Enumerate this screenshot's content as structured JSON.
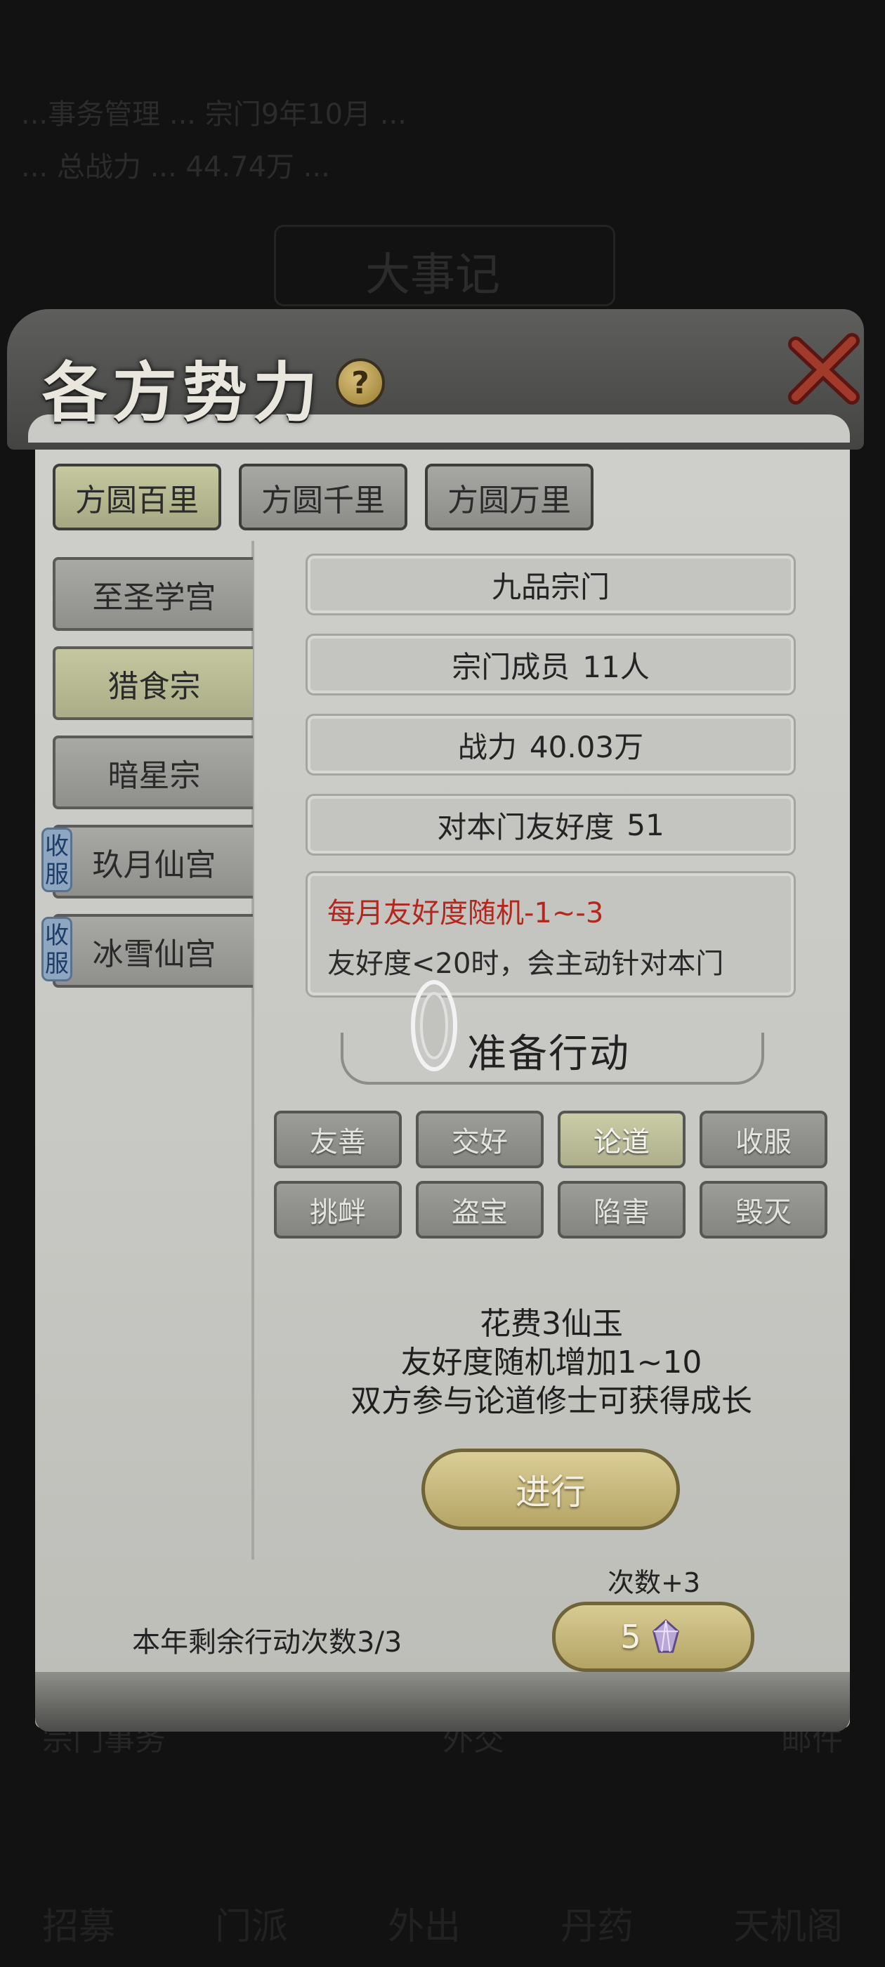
{
  "background": {
    "row1": "...事务管理 ... 宗门9年10月 ... ",
    "row2": "... 总战力 ... 44.74万 ... ",
    "title": "大事记",
    "tabs": [
      "宗门事务",
      "外交",
      "邮件"
    ],
    "bottom": [
      "招募",
      "门派",
      "外出",
      "丹药",
      "天机阁"
    ]
  },
  "panel": {
    "title": "各方势力",
    "help_symbol": "?"
  },
  "top_tabs": [
    {
      "label": "方圆百里",
      "active": true
    },
    {
      "label": "方圆千里",
      "active": false
    },
    {
      "label": "方圆万里",
      "active": false
    }
  ],
  "factions": [
    {
      "name": "至圣学宫",
      "active": false,
      "badge": ""
    },
    {
      "name": "猎食宗",
      "active": true,
      "badge": ""
    },
    {
      "name": "暗星宗",
      "active": false,
      "badge": ""
    },
    {
      "name": "玖月仙宫",
      "active": false,
      "badge": "收服"
    },
    {
      "name": "冰雪仙宫",
      "active": false,
      "badge": "收服"
    }
  ],
  "info": {
    "grade": "九品宗门",
    "members_label": "宗门成员",
    "members_value": "11人",
    "power_label": "战力",
    "power_value": "40.03万",
    "friendship_label": "对本门友好度",
    "friendship_value": "51",
    "note_red": "每月友好度随机-1~-3",
    "note_black": "友好度<20时，会主动针对本门"
  },
  "section_title": "准备行动",
  "actions": [
    {
      "label": "友善",
      "active": false
    },
    {
      "label": "交好",
      "active": false
    },
    {
      "label": "论道",
      "active": true
    },
    {
      "label": "收服",
      "active": false
    },
    {
      "label": "挑衅",
      "active": false
    },
    {
      "label": "盗宝",
      "active": false
    },
    {
      "label": "陷害",
      "active": false
    },
    {
      "label": "毁灭",
      "active": false
    }
  ],
  "description": {
    "line1": "花费3仙玉",
    "line2": "友好度随机增加1~10",
    "line3": "双方参与论道修士可获得成长"
  },
  "go_button": "进行",
  "times_plus": "次数+3",
  "buy_cost": "5",
  "remaining_text": "本年剩余行动次数3/3",
  "colors": {
    "accent_red": "#b2281e",
    "badge_blue": "#1c3d6a",
    "gold": "#c8b97c"
  }
}
